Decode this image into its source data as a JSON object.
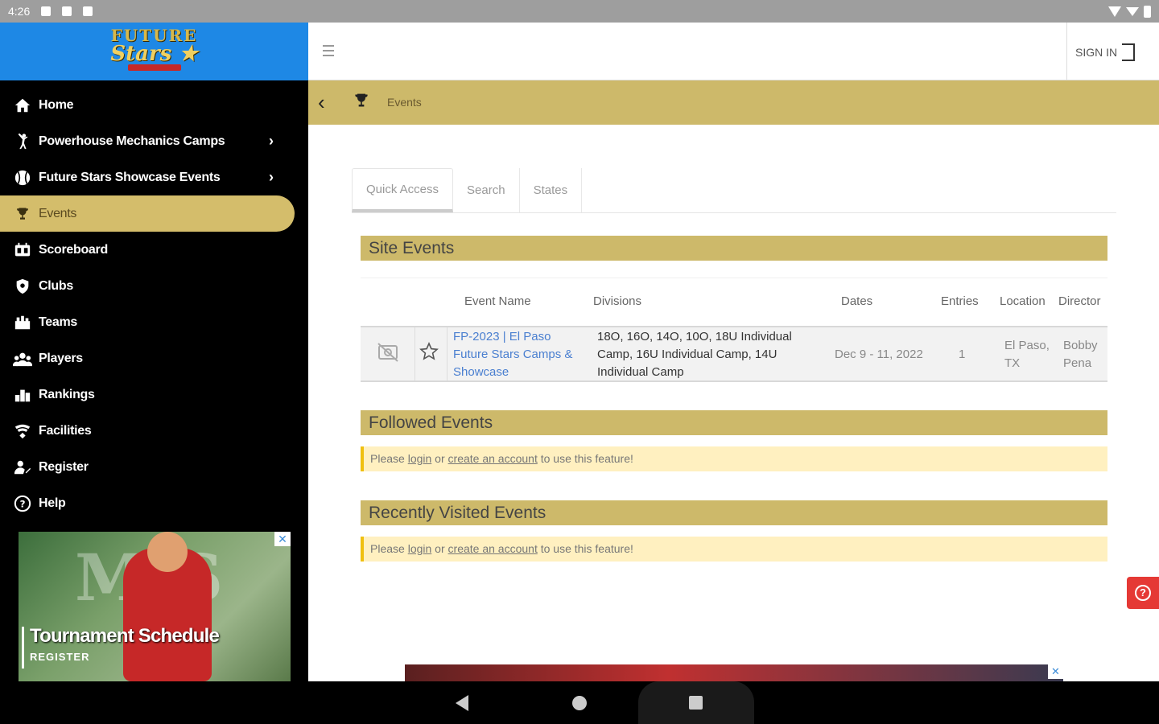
{
  "status_bar": {
    "time": "4:26"
  },
  "sidebar": {
    "logo": {
      "line1": "FUTURE",
      "line2": "Stars ★"
    },
    "items": [
      {
        "label": "Home",
        "icon": "home-icon",
        "has_submenu": false,
        "active": false
      },
      {
        "label": "Powerhouse Mechanics Camps",
        "icon": "pitcher-icon",
        "has_submenu": true,
        "active": false
      },
      {
        "label": "Future Stars Showcase Events",
        "icon": "baseball-icon",
        "has_submenu": true,
        "active": false
      },
      {
        "label": "Events",
        "icon": "trophy-icon",
        "has_submenu": false,
        "active": true
      },
      {
        "label": "Scoreboard",
        "icon": "scoreboard-icon",
        "has_submenu": false,
        "active": false
      },
      {
        "label": "Clubs",
        "icon": "shield-icon",
        "has_submenu": false,
        "active": false
      },
      {
        "label": "Teams",
        "icon": "teams-icon",
        "has_submenu": false,
        "active": false
      },
      {
        "label": "Players",
        "icon": "players-icon",
        "has_submenu": false,
        "active": false
      },
      {
        "label": "Rankings",
        "icon": "rankings-icon",
        "has_submenu": false,
        "active": false
      },
      {
        "label": "Facilities",
        "icon": "facilities-icon",
        "has_submenu": false,
        "active": false
      },
      {
        "label": "Register",
        "icon": "register-icon",
        "has_submenu": false,
        "active": false
      },
      {
        "label": "Help",
        "icon": "help-icon",
        "has_submenu": false,
        "active": false
      }
    ],
    "ad": {
      "title": "Tournament Schedule",
      "subtitle": "REGISTER",
      "wall_text": "MJS",
      "close": "✕"
    }
  },
  "header": {
    "signin_label": "SIGN IN"
  },
  "breadcrumb": {
    "label": "Events"
  },
  "tabs": [
    {
      "label": "Quick Access",
      "active": true
    },
    {
      "label": "Search",
      "active": false
    },
    {
      "label": "States",
      "active": false
    }
  ],
  "site_events": {
    "title": "Site Events",
    "columns": [
      "Event Name",
      "Divisions",
      "Dates",
      "Entries",
      "Location",
      "Director"
    ],
    "rows": [
      {
        "event_name_line1": "FP-2023 | El Paso",
        "event_name_line2": "Future Stars Camps &",
        "event_name_line3": "Showcase",
        "divisions_line1": "18O, 16O, 14O, 10O, 18U Individual",
        "divisions_line2": "Camp, 16U Individual Camp, 14U",
        "divisions_line3": "Individual Camp",
        "dates": "Dec 9 - 11, 2022",
        "entries": "1",
        "location_line1": "El Paso,",
        "location_line2": "TX",
        "director_line1": "Bobby",
        "director_line2": "Pena"
      }
    ]
  },
  "followed_events": {
    "title": "Followed Events",
    "notice": {
      "prefix": "Please ",
      "login": "login",
      "mid": " or ",
      "create": "create an account",
      "suffix": " to use this feature!"
    }
  },
  "recent_events": {
    "title": "Recently Visited Events",
    "notice": {
      "prefix": "Please ",
      "login": "login",
      "mid": " or ",
      "create": "create an account",
      "suffix": " to use this feature!"
    }
  },
  "help_fab": {
    "symbol": "?"
  },
  "bottom_ad": {
    "close": "✕"
  },
  "colors": {
    "sidebar_bg": "#000000",
    "logo_bg": "#1e88e5",
    "accent_gold": "#cdb96a",
    "link_blue": "#4a7fd0",
    "notice_bg": "#fff0c0",
    "help_red": "#e53935"
  }
}
